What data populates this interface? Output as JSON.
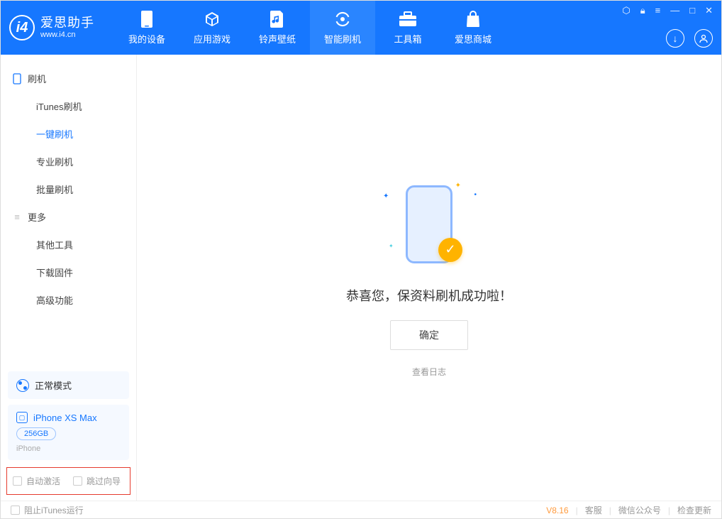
{
  "app": {
    "title": "爱思助手",
    "subtitle": "www.i4.cn"
  },
  "nav": {
    "tabs": [
      {
        "label": "我的设备"
      },
      {
        "label": "应用游戏"
      },
      {
        "label": "铃声壁纸"
      },
      {
        "label": "智能刷机"
      },
      {
        "label": "工具箱"
      },
      {
        "label": "爱思商城"
      }
    ]
  },
  "sidebar": {
    "group1": {
      "title": "刷机",
      "items": [
        "iTunes刷机",
        "一键刷机",
        "专业刷机",
        "批量刷机"
      ]
    },
    "group2": {
      "title": "更多",
      "items": [
        "其他工具",
        "下载固件",
        "高级功能"
      ]
    },
    "mode": "正常模式",
    "device": {
      "name": "iPhone XS Max",
      "storage": "256GB",
      "type": "iPhone"
    },
    "options": {
      "opt1": "自动激活",
      "opt2": "跳过向导"
    }
  },
  "main": {
    "success_text": "恭喜您，保资料刷机成功啦！",
    "confirm": "确定",
    "view_log": "查看日志"
  },
  "footer": {
    "block_itunes": "阻止iTunes运行",
    "version": "V8.16",
    "links": [
      "客服",
      "微信公众号",
      "检查更新"
    ]
  }
}
